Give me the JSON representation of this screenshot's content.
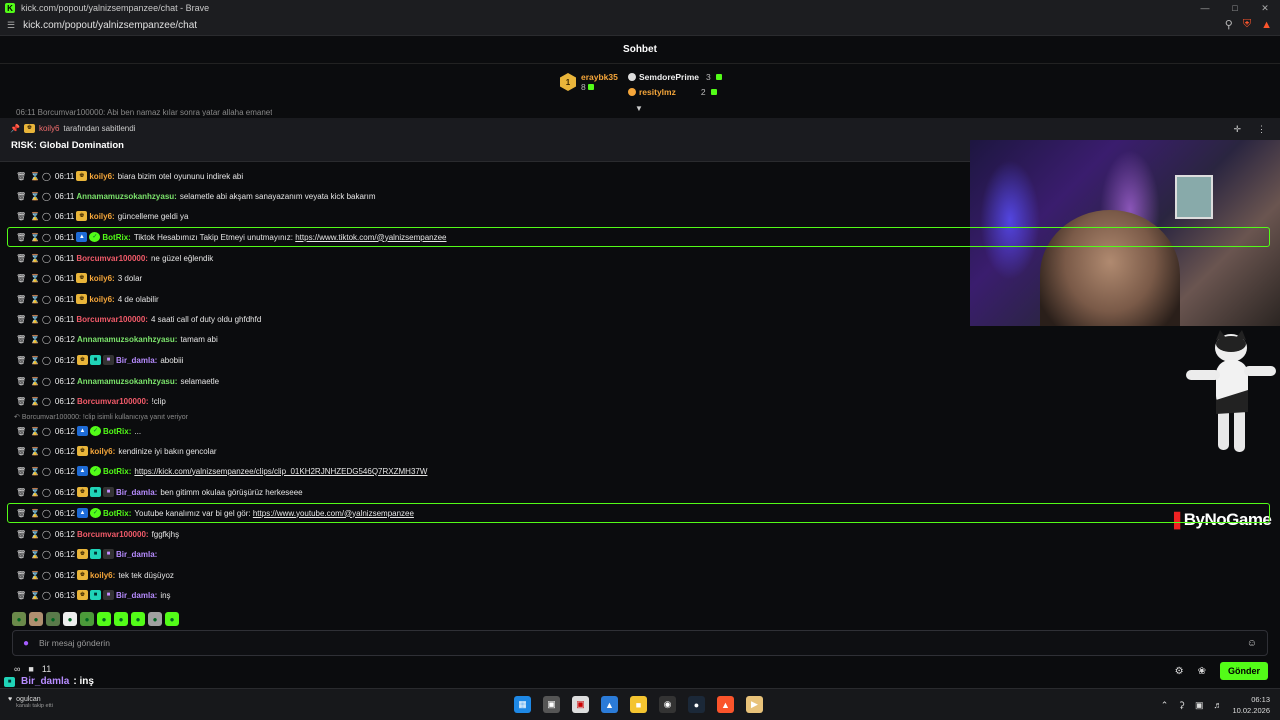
{
  "browser": {
    "window_title": "kick.com/popout/yalnizsempanzee/chat - Brave",
    "url": "kick.com/popout/yalnizsempanzee/chat"
  },
  "chat_header": {
    "title": "Sohbet"
  },
  "leaderboard": {
    "first": {
      "rank": "1",
      "name": "eraybk35",
      "count": "8"
    },
    "second": {
      "name": "SemdorePrime",
      "count": "3"
    },
    "third": {
      "name": "resitylmz",
      "count": "2"
    }
  },
  "cutoff_message": "06:11 Borcumvar100000: Abi ben namaz kılar sonra yatar allaha emanet",
  "pinned": {
    "user": "koily6",
    "by_text": "tarafından sabitlendi",
    "title": "RISK: Global Domination"
  },
  "messages": [
    {
      "time": "06:11",
      "user": "koily6",
      "text": "biara bizim otel oyununu indirek abi"
    },
    {
      "time": "06:11",
      "user": "Annamamuzsokanhzyasu",
      "text": "selametle abi akşam sanayazanım veyata kick bakarım"
    },
    {
      "time": "06:11",
      "user": "koily6",
      "text": "güncelleme geldi ya"
    },
    {
      "time": "06:11",
      "user": "BotRix",
      "text": "Tiktok Hesabımızı Takip Etmeyi unutmayınız:",
      "link": "https://www.tiktok.com/@yalnizsempanzee"
    },
    {
      "time": "06:11",
      "user": "Borcumvar100000",
      "text": "ne güzel eğlendik"
    },
    {
      "time": "06:11",
      "user": "koily6",
      "text": "3 dolar"
    },
    {
      "time": "06:11",
      "user": "koily6",
      "text": "4 de olabilir"
    },
    {
      "time": "06:11",
      "user": "Borcumvar100000",
      "text": "4 saati call of duty oldu ghfdhfd"
    },
    {
      "time": "06:12",
      "user": "Annamamuzsokanhzyasu",
      "text": "tamam abi"
    },
    {
      "time": "06:12",
      "user": "Bir_damla",
      "text": "abobiii"
    },
    {
      "time": "06:12",
      "user": "Annamamuzsokanhzyasu",
      "text": "selamaetle"
    },
    {
      "time": "06:12",
      "user": "Borcumvar100000",
      "text": "!clip"
    },
    {
      "time": "06:12",
      "user": "BotRix",
      "text": "..."
    },
    {
      "time": "06:12",
      "user": "koily6",
      "text": "kendinize iyi bakın gencolar"
    },
    {
      "time": "06:12",
      "user": "BotRix",
      "text": "",
      "link": "https://kick.com/yalnizsempanzee/clips/clip_01KH2RJNHZEDG546Q7RXZMH37W"
    },
    {
      "time": "06:12",
      "user": "Bir_damla",
      "text": "ben gitimm okulaa görüşürüz herkeseee"
    },
    {
      "time": "06:12",
      "user": "BotRix",
      "text": "Youtube kanalımız var bi gel gör:",
      "link": "https://www.youtube.com/@yalnizsempanzee"
    },
    {
      "time": "06:12",
      "user": "Borcumvar100000",
      "text": "fggfkjhş"
    },
    {
      "time": "06:12",
      "user": "Bir_damla",
      "text": ""
    },
    {
      "time": "06:12",
      "user": "koily6",
      "text": "tek tek düşüyoz"
    },
    {
      "time": "06:13",
      "user": "Bir_damla",
      "text": "inş"
    }
  ],
  "reply_context": "Borcumvar100000: !clip isimli kullanıcıya yanıt veriyor",
  "input": {
    "placeholder": "Bir mesaj gönderin"
  },
  "tools": {
    "viewer_count": "11",
    "send_label": "Gönder"
  },
  "overlay_chat": {
    "name": "Bir_damla",
    "text": ": inş"
  },
  "overlay_brand": "ByNoGame",
  "follow_notice": {
    "name": "ogulcan",
    "text": "kanalı takip etti"
  },
  "clock": {
    "time": "06:13",
    "date": "10.02.2026"
  },
  "colors": {
    "kick_green": "#53fc18",
    "username_red": "#f35b6a",
    "username_orange": "#f5a63a",
    "username_green": "#7be36b",
    "username_purple": "#b78cff"
  }
}
